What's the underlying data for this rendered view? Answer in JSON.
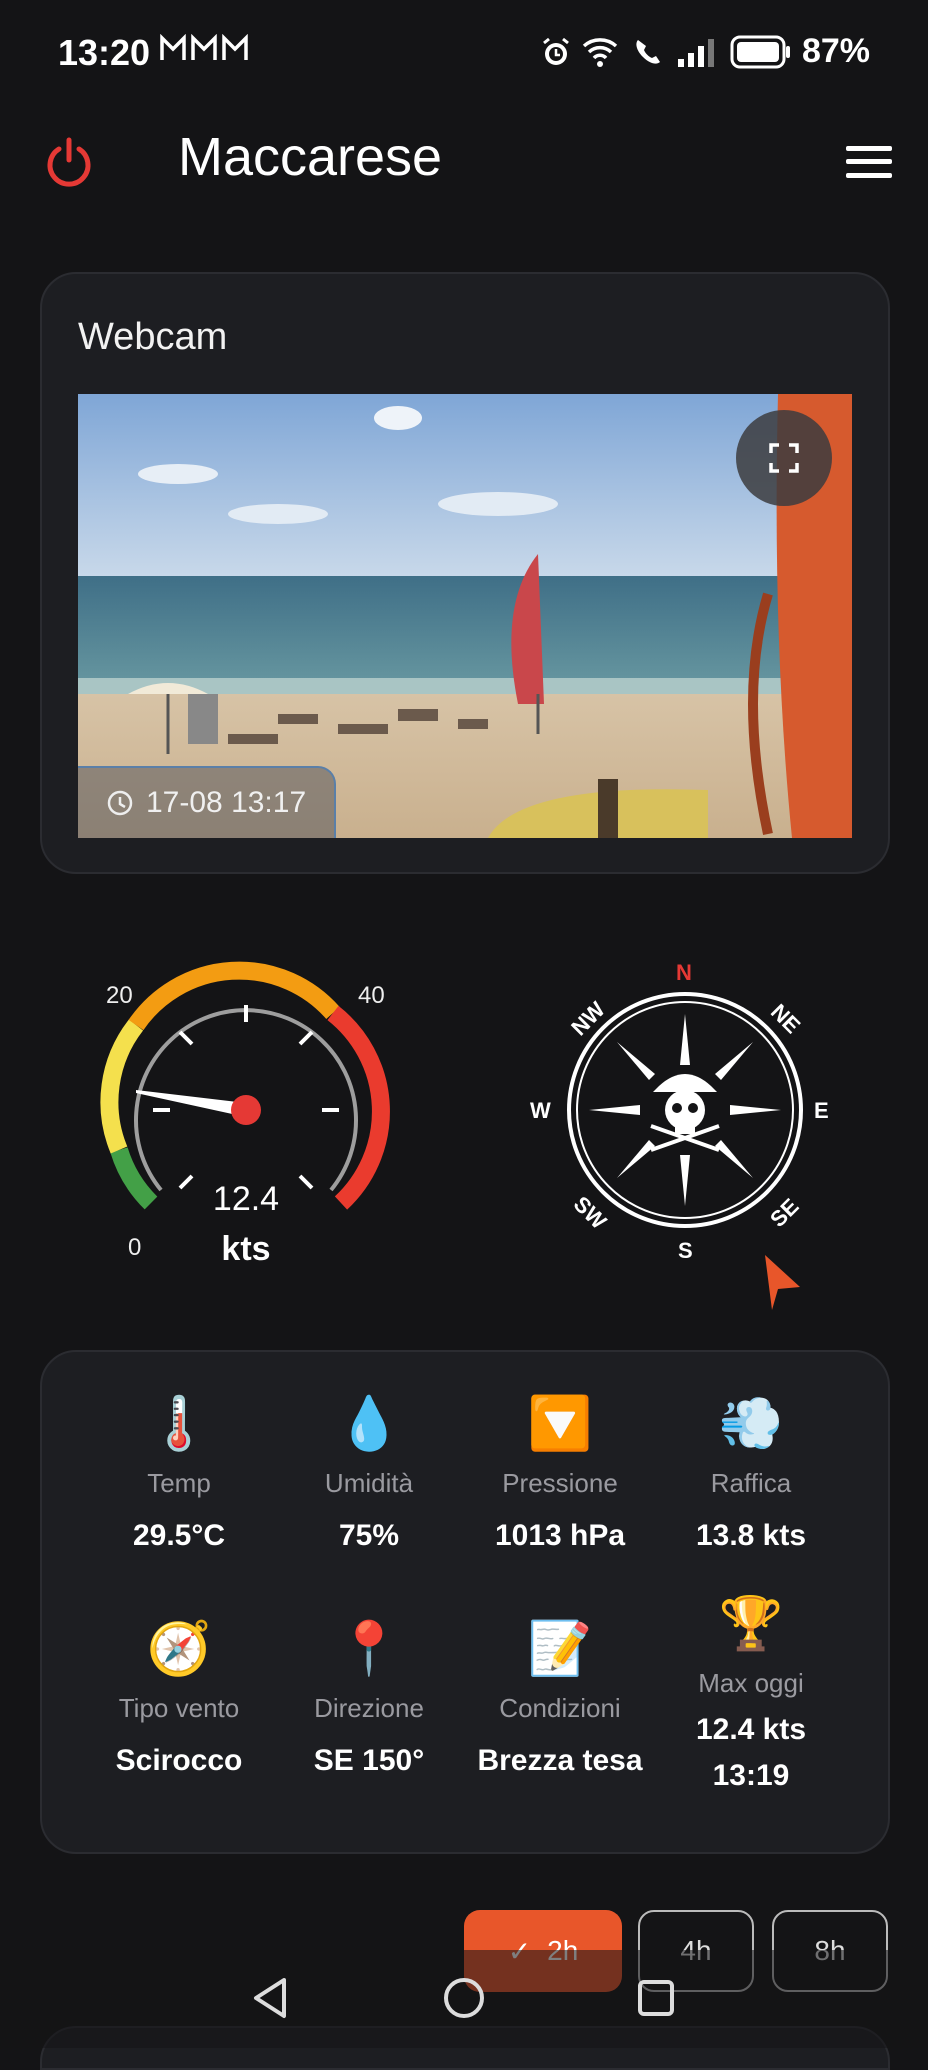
{
  "status": {
    "time": "13:20",
    "battery": "87%"
  },
  "header": {
    "title": "Maccarese"
  },
  "webcam": {
    "title": "Webcam",
    "timestamp": "17-08 13:17"
  },
  "wind_gauge": {
    "min_label": "0",
    "mid_label": "20",
    "max_label": "40",
    "speed": "12.4",
    "unit": "kts"
  },
  "compass": {
    "n": "N",
    "ne": "NE",
    "e": "E",
    "se": "SE",
    "s": "S",
    "sw": "SW",
    "w": "W",
    "nw": "NW",
    "direction_deg": 150
  },
  "stats": {
    "temp": {
      "label": "Temp",
      "value": "29.5°C",
      "icon": "thermometer-icon"
    },
    "humidity": {
      "label": "Umidità",
      "value": "75%",
      "icon": "droplet-icon"
    },
    "pressure": {
      "label": "Pressione",
      "value": "1013 hPa",
      "icon": "down-arrow-icon"
    },
    "gust": {
      "label": "Raffica",
      "value": "13.8 kts",
      "icon": "wind-icon"
    },
    "wind_type": {
      "label": "Tipo vento",
      "value": "Scirocco",
      "icon": "compass-icon"
    },
    "direction": {
      "label": "Direzione",
      "value": "SE 150°",
      "icon": "pin-icon"
    },
    "conditions": {
      "label": "Condizioni",
      "value": "Brezza tesa",
      "icon": "memo-icon"
    },
    "max_today": {
      "label": "Max oggi",
      "value": "12.4 kts",
      "time": "13:19",
      "icon": "trophy-icon"
    }
  },
  "ranges": {
    "r2": "2h",
    "r4": "4h",
    "r8": "8h",
    "selected": "2h"
  },
  "colors": {
    "accent": "#e8562a",
    "power_red": "#e53935"
  }
}
